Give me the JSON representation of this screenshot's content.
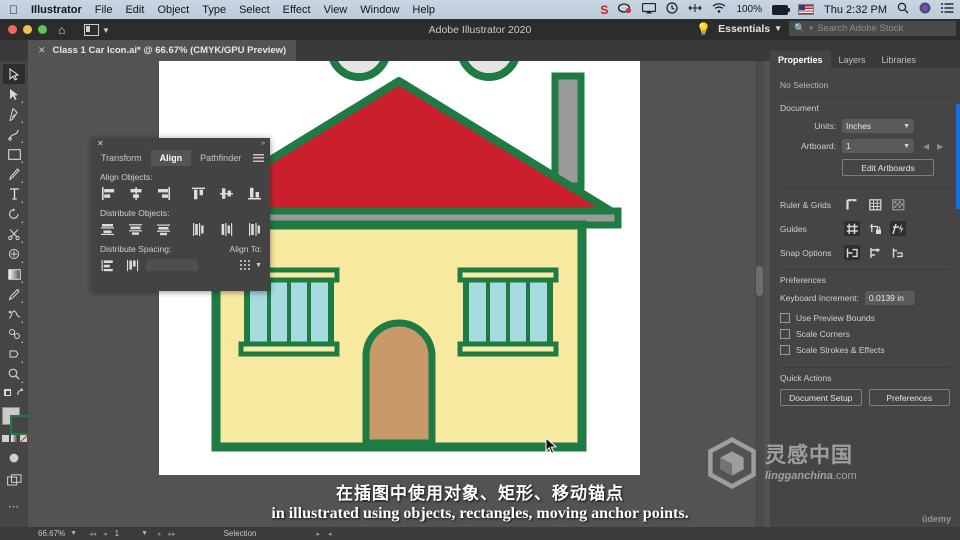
{
  "mac_menu": {
    "apple_icon": "apple-icon",
    "app_name": "Illustrator",
    "items": [
      "File",
      "Edit",
      "Object",
      "Type",
      "Select",
      "Effect",
      "View",
      "Window",
      "Help"
    ],
    "status": {
      "sophos_icon": "S",
      "battery_percent": "100%",
      "clock": "Thu 2:32 PM",
      "search_icon": "search-icon",
      "siri_icon": "siri-icon",
      "list_icon": "notification-center-icon"
    }
  },
  "app_bar": {
    "title": "Adobe Illustrator 2020",
    "home_icon": "home-icon",
    "arrange_icon": "arrange-documents-icon",
    "bulb_icon": "discover-icon",
    "workspace": "Essentials",
    "search_placeholder": "Search Adobe Stock"
  },
  "document_tab": {
    "close_icon": "close-icon",
    "label": "Class 1 Car Icon.ai* @ 66.67% (CMYK/GPU Preview)"
  },
  "toolbar": {
    "tools": [
      {
        "name": "selection-tool",
        "glyph": "▷",
        "selected": true
      },
      {
        "name": "direct-selection-tool",
        "glyph": "▶",
        "selected": false
      },
      {
        "name": "pen-tool",
        "glyph": "✒",
        "selected": false
      },
      {
        "name": "curvature-tool",
        "glyph": "✎",
        "selected": false
      },
      {
        "name": "rectangle-tool",
        "glyph": "□",
        "selected": false
      },
      {
        "name": "paintbrush-tool",
        "glyph": "✏",
        "selected": false
      },
      {
        "name": "type-tool",
        "glyph": "T",
        "selected": false
      },
      {
        "name": "rotate-tool",
        "glyph": "↻",
        "selected": false
      },
      {
        "name": "scissors-tool",
        "glyph": "✂",
        "selected": false
      },
      {
        "name": "free-transform-tool",
        "glyph": "⧉",
        "selected": false
      },
      {
        "name": "gradient-tool",
        "glyph": "▧",
        "selected": false
      },
      {
        "name": "eyedropper-tool",
        "glyph": "↘",
        "selected": false
      },
      {
        "name": "blend-tool",
        "glyph": "☘",
        "selected": false
      },
      {
        "name": "symbol-sprayer-tool",
        "glyph": "❦",
        "selected": false
      },
      {
        "name": "shaper-tool",
        "glyph": "⬠",
        "selected": false
      },
      {
        "name": "artboard-tool",
        "glyph": "⌧",
        "selected": false
      },
      {
        "name": "zoom-tool",
        "glyph": "⚲",
        "selected": false
      },
      {
        "name": "swap-fill-stroke-icon",
        "glyph": "↱",
        "selected": false
      }
    ],
    "fill_color": "#c9c9c9",
    "stroke_color": "#1e7b44",
    "more_tools_icon": "edit-toolbar-icon"
  },
  "align_panel": {
    "close_icon": "close-icon",
    "collapse_icon": "collapse-icon",
    "menu_icon": "panel-menu-icon",
    "tabs": [
      {
        "label": "Transform",
        "active": false
      },
      {
        "label": "Align",
        "active": true
      },
      {
        "label": "Pathfinder",
        "active": false
      }
    ],
    "align_objects_label": "Align Objects:",
    "align_objects_buttons": [
      "align-left-icon",
      "align-horizontal-center-icon",
      "align-right-icon",
      "align-top-icon",
      "align-vertical-center-icon",
      "align-bottom-icon"
    ],
    "distribute_objects_label": "Distribute Objects:",
    "distribute_objects_buttons": [
      "distribute-vertical-top-icon",
      "distribute-vertical-center-icon",
      "distribute-vertical-bottom-icon",
      "distribute-horizontal-left-icon",
      "distribute-horizontal-center-icon",
      "distribute-horizontal-right-icon"
    ],
    "distribute_spacing_label": "Distribute Spacing:",
    "distribute_spacing_buttons": [
      "distribute-vertical-spacing-icon",
      "distribute-horizontal-spacing-icon"
    ],
    "spacing_value": "",
    "align_to_label": "Align To:",
    "align_to_icon": "align-to-selection-icon"
  },
  "properties_panel": {
    "tabs": [
      {
        "label": "Properties",
        "active": true
      },
      {
        "label": "Layers",
        "active": false
      },
      {
        "label": "Libraries",
        "active": false
      }
    ],
    "selection_status": "No Selection",
    "document_heading": "Document",
    "units_label": "Units:",
    "units_value": "Inches",
    "artboard_label": "Artboard:",
    "artboard_value": "1",
    "prev_artboard_icon": "chevron-left-icon",
    "next_artboard_icon": "chevron-right-icon",
    "edit_artboards_label": "Edit Artboards",
    "ruler_grids_label": "Ruler & Grids",
    "ruler_grids_buttons": [
      "show-rulers-icon",
      "show-grid-icon",
      "show-transparency-grid-icon"
    ],
    "guides_label": "Guides",
    "guides_buttons": [
      "show-guides-icon",
      "lock-guides-icon",
      "smart-guides-icon"
    ],
    "snap_options_label": "Snap Options",
    "snap_options_buttons": [
      "snap-to-point-icon",
      "snap-to-grid-icon",
      "snap-to-pixel-icon"
    ],
    "preferences_heading": "Preferences",
    "keyboard_increment_label": "Keyboard Increment:",
    "keyboard_increment_value": "0.0139 in",
    "checkboxes": [
      {
        "label": "Use Preview Bounds",
        "checked": false
      },
      {
        "label": "Scale Corners",
        "checked": false
      },
      {
        "label": "Scale Strokes & Effects",
        "checked": false
      }
    ],
    "quick_actions_heading": "Quick Actions",
    "quick_actions": [
      "Document Setup",
      "Preferences"
    ]
  },
  "status_bar": {
    "zoom": "66.67%",
    "zoom_dropdown_icon": "chevron-down-icon",
    "first_page_icon": "first-artboard-icon",
    "prev_page_icon": "prev-artboard-icon",
    "page": "1",
    "page_dropdown_icon": "chevron-down-icon",
    "next_page_icon": "next-artboard-icon",
    "last_page_icon": "last-artboard-icon",
    "tool_name": "Selection",
    "play_icon": "play-icon",
    "resize_icon": "resize-icon"
  },
  "artwork": {
    "name": "house-illustration",
    "colors": {
      "roof": "#cc1f2e",
      "outline": "#1e7b44",
      "wall": "#f8e9a0",
      "window_glass": "#a6dbe0",
      "door": "#c89a6a",
      "chimney": "#9a9a9a",
      "eave": "#9a9a9a"
    },
    "partial_shapes": [
      "wheel-left",
      "wheel-right"
    ]
  },
  "subtitles": {
    "chinese": "在插图中使用对象、矩形、移动锚点",
    "english": "in illustrated using objects, rectangles, moving anchor points."
  },
  "watermark": {
    "chinese": "灵感中国",
    "domain_bold": "lingganchina",
    "domain_tld": ".com",
    "platform": "ūdemy"
  }
}
